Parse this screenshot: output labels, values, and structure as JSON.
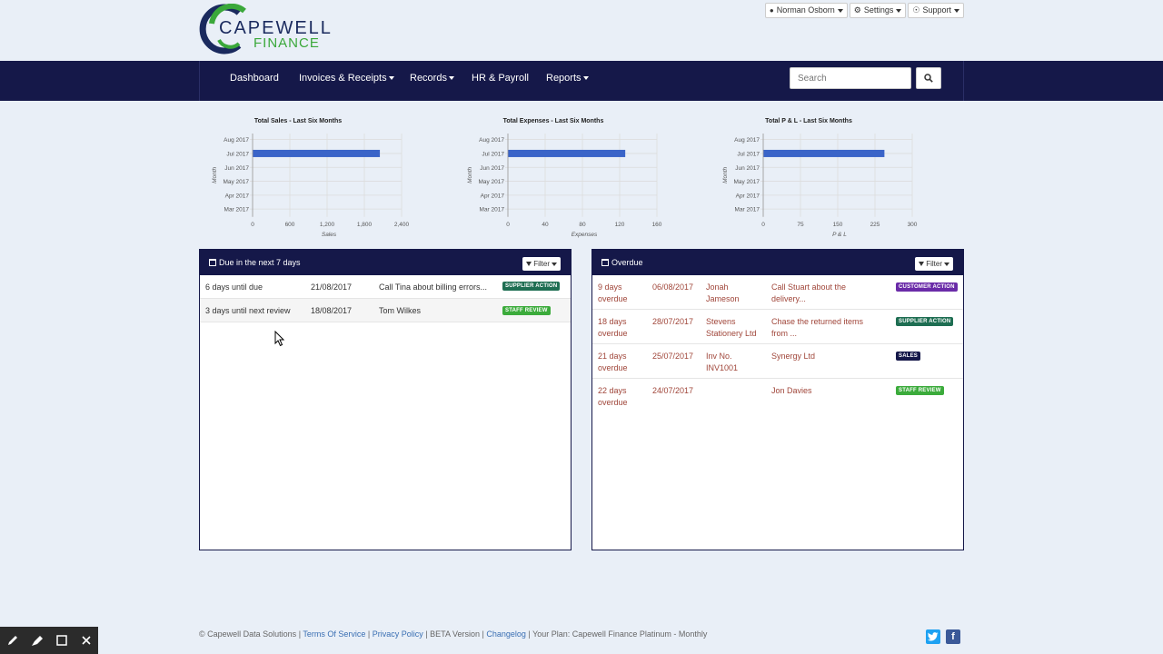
{
  "logo": {
    "line1": "CAPEWELL",
    "line2": "FINANCE"
  },
  "user_menu": [
    {
      "label": "Norman Osborn",
      "icon": "user-icon"
    },
    {
      "label": "Settings",
      "icon": "gear-icon"
    },
    {
      "label": "Support",
      "icon": "lifebuoy-icon"
    }
  ],
  "nav": {
    "items": [
      {
        "label": "Dashboard",
        "caret": false
      },
      {
        "label": "Invoices & Receipts",
        "caret": true
      },
      {
        "label": "Records",
        "caret": true
      },
      {
        "label": "HR & Payroll",
        "caret": false
      },
      {
        "label": "Reports",
        "caret": true
      }
    ],
    "search_placeholder": "Search"
  },
  "charts": [
    {
      "type": "bar",
      "title": "Total Sales - Last Six Months",
      "ylabel": "Month",
      "xlabel": "Sales",
      "categories": [
        "Aug 2017",
        "Jul 2017",
        "Jun 2017",
        "May 2017",
        "Apr 2017",
        "Mar 2017"
      ],
      "values": [
        0,
        2050,
        0,
        0,
        0,
        0
      ],
      "xticks": [
        "0",
        "600",
        "1,200",
        "1,800",
        "2,400"
      ],
      "xlim": [
        0,
        2400
      ],
      "bar_color": "#3a64c8"
    },
    {
      "type": "bar",
      "title": "Total Expenses - Last Six Months",
      "ylabel": "Month",
      "xlabel": "Expenses",
      "categories": [
        "Aug 2017",
        "Jul 2017",
        "Jun 2017",
        "May 2017",
        "Apr 2017",
        "Mar 2017"
      ],
      "values": [
        0,
        126,
        0,
        0,
        0,
        0
      ],
      "xticks": [
        "0",
        "40",
        "80",
        "120",
        "160"
      ],
      "xlim": [
        0,
        160
      ],
      "bar_color": "#3a64c8"
    },
    {
      "type": "bar",
      "title": "Total P & L - Last Six Months",
      "ylabel": "Month",
      "xlabel": "P & L",
      "categories": [
        "Aug 2017",
        "Jul 2017",
        "Jun 2017",
        "May 2017",
        "Apr 2017",
        "Mar 2017"
      ],
      "values": [
        0,
        244,
        0,
        0,
        0,
        0
      ],
      "xticks": [
        "0",
        "75",
        "150",
        "225",
        "300"
      ],
      "xlim": [
        0,
        300
      ],
      "bar_color": "#3a64c8"
    }
  ],
  "due_panel": {
    "title": "Due in the next 7 days",
    "filter_label": "Filter",
    "rows": [
      {
        "when": "6 days until due",
        "date": "21/08/2017",
        "desc": "Call Tina about billing errors...",
        "badge": "SUPPLIER ACTION",
        "badge_type": "supplier"
      },
      {
        "when": "3 days until next review",
        "date": "18/08/2017",
        "desc": "Tom Wilkes",
        "badge": "STAFF REVIEW",
        "badge_type": "staff"
      }
    ]
  },
  "overdue_panel": {
    "title": "Overdue",
    "filter_label": "Filter",
    "rows": [
      {
        "days": "9 days",
        "sub": "overdue",
        "date": "06/08/2017",
        "who1": "Jonah",
        "who2": "Jameson",
        "desc1": "Call Stuart about the",
        "desc2": "delivery...",
        "badge": "CUSTOMER ACTION",
        "badge_type": "customer"
      },
      {
        "days": "18 days",
        "sub": "overdue",
        "date": "28/07/2017",
        "who1": "Stevens",
        "who2": "Stationery Ltd",
        "desc1": "Chase the returned items",
        "desc2": "from ...",
        "badge": "SUPPLIER ACTION",
        "badge_type": "supplier"
      },
      {
        "days": "21 days",
        "sub": "overdue",
        "date": "25/07/2017",
        "who1": "Inv No.",
        "who2": "INV1001",
        "desc1": "Synergy Ltd",
        "desc2": "",
        "badge": "SALES",
        "badge_type": "sales"
      },
      {
        "days": "22 days",
        "sub": "overdue",
        "date": "24/07/2017",
        "who1": "",
        "who2": "",
        "desc1": "Jon Davies",
        "desc2": "",
        "badge": "STAFF REVIEW",
        "badge_type": "staff"
      }
    ]
  },
  "footer": {
    "copyright": "© Capewell Data Solutions |",
    "terms": "Terms Of Service",
    "sep1": "|",
    "privacy": "Privacy Policy",
    "beta": "| BETA Version |",
    "changelog": "Changelog",
    "plan": "| Your Plan: Capewell Finance Platinum - Monthly",
    "twitter_icon": "twitter-icon",
    "facebook_icon": "facebook-icon",
    "facebook_glyph": "f"
  },
  "colors": {
    "navbar": "#151849",
    "accent_green": "#3aa83a",
    "bar": "#3a64c8"
  }
}
